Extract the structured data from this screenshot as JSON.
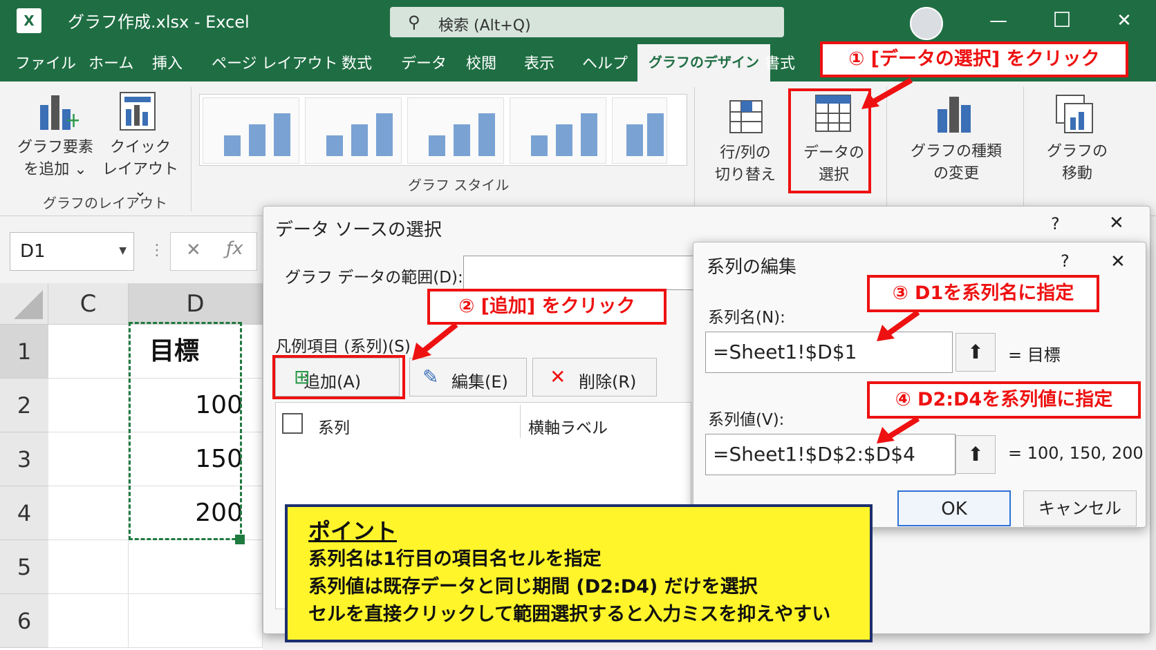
{
  "titlebar": {
    "logo": "X",
    "title": "グラフ作成.xlsx  -  Excel",
    "search": "検索 (Alt+Q)",
    "minimize": "—",
    "maximize": "☐",
    "close": "✕"
  },
  "tabs": [
    "ファイル",
    "ホーム",
    "挿入",
    "ページ レイアウト",
    "数式",
    "データ",
    "校閲",
    "表示",
    "ヘルプ",
    "グラフのデザイン",
    "書式"
  ],
  "ribbon": {
    "add_element": [
      "グラフ要素",
      "を追加 ⌄"
    ],
    "quick_layout": [
      "クイック",
      "レイアウト ⌄"
    ],
    "layout_group": "グラフのレイアウト",
    "style_group": "グラフ スタイル",
    "switch_rowcol": [
      "行/列の",
      "切り替え"
    ],
    "select_data": [
      "データの",
      "選択"
    ],
    "change_type": [
      "グラフの種類",
      "の変更"
    ],
    "move_chart": [
      "グラフの",
      "移動"
    ]
  },
  "callouts": {
    "c1": "① [データの選択] をクリック",
    "c2": "② [追加] をクリック",
    "c3": "③ D1を系列名に指定",
    "c4": "④ D2:D4を系列値に指定"
  },
  "namebox": "D1",
  "sheet": {
    "cols": [
      "C",
      "D"
    ],
    "rows": [
      "1",
      "2",
      "3",
      "4",
      "5",
      "6"
    ],
    "d_values": [
      "目標",
      "100",
      "150",
      "200",
      "",
      ""
    ]
  },
  "source_dialog": {
    "title": "データ ソースの選択",
    "help": "?",
    "close": "✕",
    "range_label": "グラフ データの範囲(D):",
    "legend_label": "凡例項目 (系列)(S)",
    "add": "追加(A)",
    "edit": "編集(E)",
    "delete": "削除(R)",
    "col_series": "系列",
    "col_axis": "横軸ラベル"
  },
  "series_dialog": {
    "title": "系列の編集",
    "help": "?",
    "close": "✕",
    "name_label": "系列名(N):",
    "name_value": "=Sheet1!$D$1",
    "name_preview": "= 目標",
    "values_label": "系列値(V):",
    "values_value": "=Sheet1!$D$2:$D$4",
    "values_preview": "= 100, 150, 200",
    "ok": "OK",
    "cancel": "キャンセル"
  },
  "point": {
    "heading": "ポイント",
    "lines": [
      "系列名は1行目の項目名セルを指定",
      "系列値は既存データと同じ期間 (D2:D4) だけを選択",
      "セルを直接クリックして範囲選択すると入力ミスを抑えやすい"
    ]
  }
}
